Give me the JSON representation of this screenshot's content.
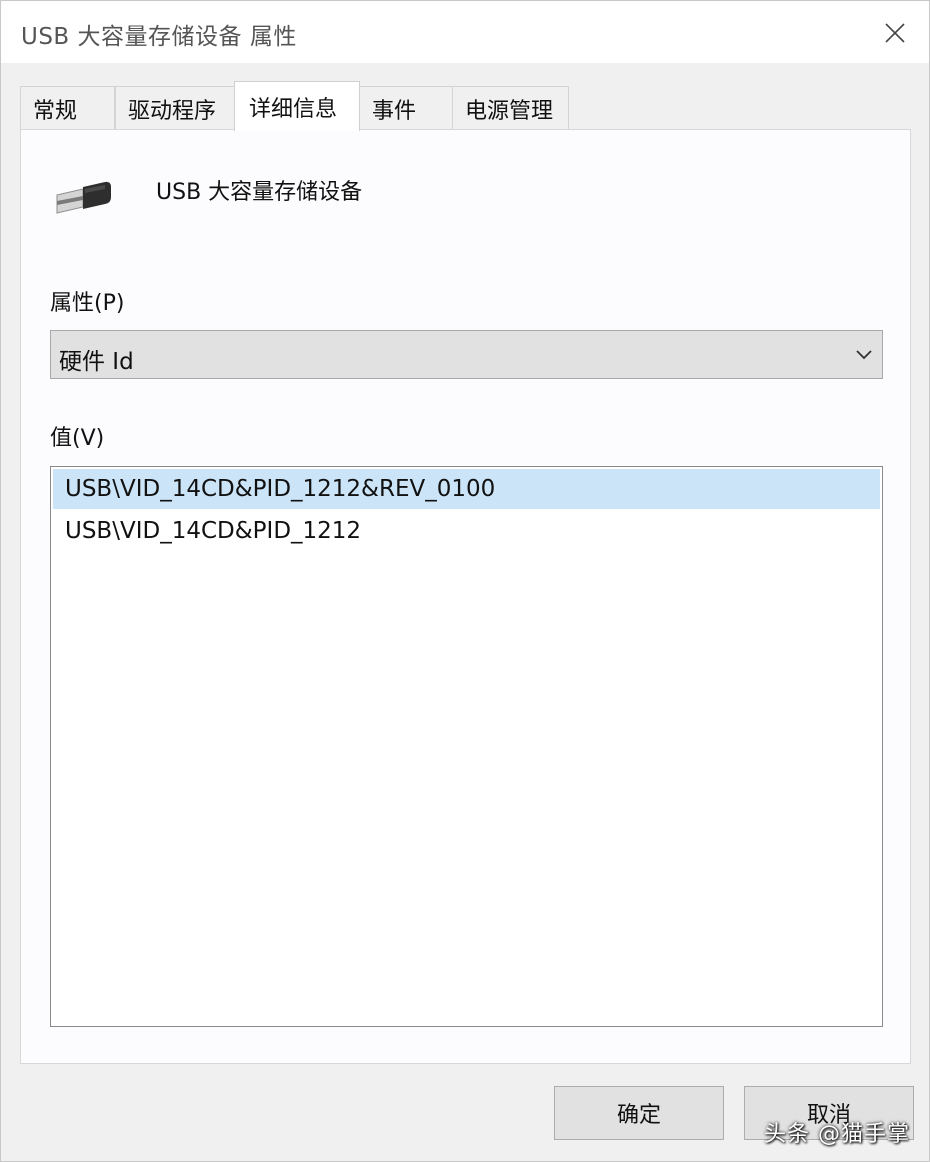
{
  "window": {
    "title": "USB 大容量存储设备 属性"
  },
  "tabs": [
    {
      "label": "常规"
    },
    {
      "label": "驱动程序"
    },
    {
      "label": "详细信息"
    },
    {
      "label": "事件"
    },
    {
      "label": "电源管理"
    }
  ],
  "active_tab": "详细信息",
  "device": {
    "name": "USB 大容量存储设备",
    "icon": "usb-plug-icon"
  },
  "property": {
    "label": "属性(P)",
    "selected": "硬件 Id"
  },
  "values": {
    "label": "值(V)",
    "items": [
      {
        "text": "USB\\VID_14CD&PID_1212&REV_0100"
      },
      {
        "text": "USB\\VID_14CD&PID_1212"
      }
    ],
    "selected_index": 0
  },
  "buttons": {
    "ok_label": "确定",
    "cancel_label": "取消"
  },
  "watermark": "头条 @猫手掌",
  "colors": {
    "selection": "#cce4f7",
    "button_bg": "#e1e1e1",
    "window_bg": "#f0f0f0"
  }
}
